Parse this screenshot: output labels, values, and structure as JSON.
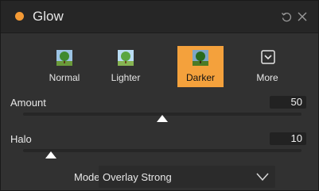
{
  "panel": {
    "title": "Glow",
    "accent_color": "#f49a35",
    "header_icons": [
      "reset-icon",
      "close-icon"
    ]
  },
  "presets": [
    {
      "label": "Normal",
      "icon": "tree-icon",
      "active": false
    },
    {
      "label": "Lighter",
      "icon": "tree-icon",
      "active": false
    },
    {
      "label": "Darker",
      "icon": "tree-icon",
      "active": true
    },
    {
      "label": "More",
      "icon": "chevron-down-box-icon",
      "active": false
    }
  ],
  "sliders": {
    "amount": {
      "label": "Amount",
      "value": "50",
      "fraction": 0.5
    },
    "halo": {
      "label": "Halo",
      "value": "10",
      "fraction": 0.1
    }
  },
  "mode": {
    "label": "Mode",
    "value": "Overlay Strong"
  }
}
